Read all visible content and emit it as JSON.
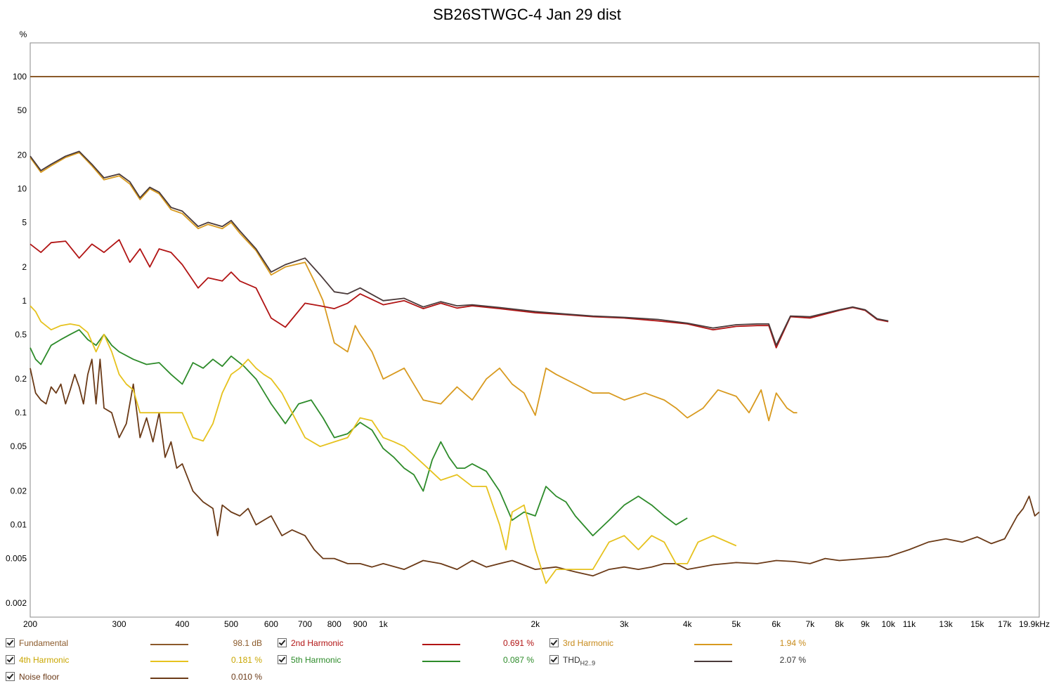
{
  "chart_data": {
    "type": "line",
    "title": "SB26STWGC-4 Jan 29 dist",
    "ylabel": "%",
    "x_scale": "log",
    "y_scale": "log",
    "xlim": [
      200,
      19900
    ],
    "ylim": [
      0.0015,
      200
    ],
    "x_ticks": [
      200,
      300,
      400,
      500,
      600,
      700,
      800,
      900,
      1000,
      2000,
      3000,
      4000,
      5000,
      6000,
      7000,
      8000,
      9000,
      10000,
      11000,
      13000,
      15000,
      17000,
      19900
    ],
    "x_tick_labels": [
      "200",
      "300",
      "400",
      "500",
      "600",
      "700",
      "800",
      "900",
      "1k",
      "2k",
      "3k",
      "4k",
      "5k",
      "6k",
      "7k",
      "8k",
      "9k",
      "10k",
      "11k",
      "13k",
      "15k",
      "17k",
      "19.9kHz"
    ],
    "y_ticks": [
      100,
      50,
      20,
      10,
      5,
      2,
      1,
      0.5,
      0.2,
      0.1,
      0.05,
      0.02,
      0.01,
      0.005,
      0.002
    ],
    "y_tick_labels": [
      "100",
      "50",
      "20",
      "10",
      "5",
      "2",
      "1",
      "0.5",
      "0.2",
      "0.1",
      "0.05",
      "0.02",
      "0.01",
      "0.005",
      "0.002"
    ],
    "grid": true,
    "legend_position": "bottom",
    "series": [
      {
        "key": "fundamental",
        "name": "Fundamental",
        "color": "#8b5a2b",
        "x": [
          200,
          19900
        ],
        "y": [
          100,
          100
        ]
      },
      {
        "key": "h2",
        "name": "2nd Harmonic",
        "color": "#b11414",
        "x": [
          200,
          210,
          220,
          235,
          250,
          265,
          280,
          300,
          315,
          330,
          345,
          360,
          380,
          400,
          430,
          450,
          480,
          500,
          520,
          560,
          600,
          640,
          700,
          750,
          800,
          850,
          900,
          1000,
          1100,
          1200,
          1300,
          1400,
          1500,
          1700,
          2000,
          2300,
          2600,
          3000,
          3500,
          4000,
          4500,
          5000,
          5500,
          5800,
          6000,
          6400,
          7000,
          8000,
          8500,
          9000,
          9500,
          10000
        ],
        "y": [
          3.2,
          2.7,
          3.3,
          3.4,
          2.4,
          3.2,
          2.7,
          3.5,
          2.2,
          2.9,
          2.0,
          2.9,
          2.7,
          2.1,
          1.3,
          1.6,
          1.5,
          1.8,
          1.5,
          1.3,
          0.7,
          0.58,
          0.95,
          0.9,
          0.85,
          0.95,
          1.15,
          0.92,
          1.0,
          0.85,
          0.95,
          0.86,
          0.9,
          0.85,
          0.78,
          0.75,
          0.72,
          0.7,
          0.66,
          0.62,
          0.55,
          0.59,
          0.6,
          0.6,
          0.38,
          0.72,
          0.7,
          0.82,
          0.87,
          0.82,
          0.68,
          0.65
        ]
      },
      {
        "key": "h3",
        "name": "3rd Harmonic",
        "color": "#d89a1f",
        "x": [
          200,
          210,
          220,
          235,
          250,
          265,
          280,
          300,
          315,
          330,
          345,
          360,
          380,
          400,
          430,
          450,
          480,
          500,
          520,
          560,
          600,
          640,
          700,
          730,
          760,
          800,
          850,
          880,
          900,
          950,
          1000,
          1100,
          1200,
          1300,
          1400,
          1500,
          1600,
          1700,
          1800,
          1900,
          2000,
          2100,
          2200,
          2400,
          2600,
          2800,
          3000,
          3300,
          3600,
          3800,
          4000,
          4300,
          4600,
          5000,
          5300,
          5600,
          5800,
          6000,
          6300,
          6500,
          6600
        ],
        "y": [
          19,
          14,
          16,
          19,
          21,
          16,
          12,
          13,
          11,
          8,
          10,
          9,
          6.5,
          6.0,
          4.4,
          4.8,
          4.4,
          5.0,
          4.0,
          2.8,
          1.7,
          2.0,
          2.2,
          1.5,
          1.0,
          0.42,
          0.35,
          0.6,
          0.5,
          0.35,
          0.2,
          0.25,
          0.13,
          0.12,
          0.17,
          0.13,
          0.2,
          0.25,
          0.18,
          0.15,
          0.095,
          0.25,
          0.22,
          0.18,
          0.15,
          0.15,
          0.13,
          0.15,
          0.13,
          0.11,
          0.09,
          0.11,
          0.16,
          0.14,
          0.1,
          0.16,
          0.085,
          0.15,
          0.11,
          0.1,
          0.1
        ]
      },
      {
        "key": "h4",
        "name": "4th Harmonic",
        "color": "#e6c21e",
        "x": [
          200,
          205,
          210,
          220,
          230,
          240,
          250,
          260,
          270,
          280,
          290,
          300,
          310,
          320,
          330,
          345,
          360,
          380,
          400,
          420,
          440,
          460,
          480,
          500,
          520,
          540,
          560,
          580,
          600,
          630,
          660,
          700,
          750,
          800,
          850,
          900,
          950,
          1000,
          1050,
          1100,
          1200,
          1300,
          1400,
          1500,
          1600,
          1700,
          1750,
          1800,
          1900,
          2000,
          2100,
          2200,
          2300,
          2400,
          2600,
          2800,
          3000,
          3200,
          3400,
          3600,
          3800,
          4000,
          4200,
          4500,
          5000
        ],
        "y": [
          0.9,
          0.8,
          0.65,
          0.55,
          0.6,
          0.62,
          0.6,
          0.52,
          0.35,
          0.5,
          0.35,
          0.22,
          0.18,
          0.16,
          0.1,
          0.1,
          0.1,
          0.1,
          0.1,
          0.06,
          0.056,
          0.08,
          0.15,
          0.22,
          0.25,
          0.3,
          0.25,
          0.22,
          0.2,
          0.15,
          0.1,
          0.06,
          0.05,
          0.055,
          0.06,
          0.09,
          0.085,
          0.06,
          0.055,
          0.05,
          0.035,
          0.025,
          0.028,
          0.022,
          0.022,
          0.01,
          0.006,
          0.013,
          0.015,
          0.006,
          0.003,
          0.004,
          0.004,
          0.004,
          0.004,
          0.007,
          0.008,
          0.006,
          0.008,
          0.007,
          0.0045,
          0.0045,
          0.007,
          0.008,
          0.0065
        ]
      },
      {
        "key": "h5",
        "name": "5th Harmonic",
        "color": "#2d8b2a",
        "x": [
          200,
          205,
          210,
          220,
          230,
          240,
          250,
          260,
          270,
          280,
          290,
          300,
          320,
          340,
          360,
          380,
          400,
          420,
          440,
          460,
          480,
          500,
          530,
          560,
          600,
          640,
          680,
          720,
          760,
          800,
          850,
          900,
          950,
          1000,
          1050,
          1100,
          1150,
          1200,
          1250,
          1300,
          1350,
          1400,
          1450,
          1500,
          1600,
          1700,
          1800,
          1900,
          2000,
          2100,
          2200,
          2300,
          2400,
          2600,
          2800,
          3000,
          3200,
          3400,
          3600,
          3800,
          4000
        ],
        "y": [
          0.38,
          0.3,
          0.27,
          0.4,
          0.45,
          0.5,
          0.55,
          0.45,
          0.4,
          0.5,
          0.4,
          0.35,
          0.3,
          0.27,
          0.28,
          0.22,
          0.18,
          0.28,
          0.25,
          0.3,
          0.26,
          0.32,
          0.26,
          0.2,
          0.12,
          0.08,
          0.12,
          0.13,
          0.09,
          0.06,
          0.065,
          0.082,
          0.07,
          0.048,
          0.04,
          0.032,
          0.028,
          0.02,
          0.038,
          0.055,
          0.04,
          0.032,
          0.032,
          0.035,
          0.03,
          0.02,
          0.011,
          0.013,
          0.012,
          0.022,
          0.018,
          0.016,
          0.012,
          0.008,
          0.011,
          0.015,
          0.018,
          0.015,
          0.012,
          0.01,
          0.0115
        ]
      },
      {
        "key": "noise",
        "name": "Noise floor",
        "color": "#6b3a17",
        "x": [
          200,
          205,
          210,
          215,
          220,
          225,
          230,
          235,
          240,
          245,
          250,
          255,
          260,
          265,
          270,
          275,
          280,
          290,
          300,
          310,
          320,
          330,
          340,
          350,
          360,
          370,
          380,
          390,
          400,
          420,
          440,
          460,
          470,
          480,
          500,
          520,
          540,
          560,
          580,
          600,
          630,
          660,
          700,
          730,
          760,
          800,
          850,
          900,
          950,
          1000,
          1100,
          1200,
          1300,
          1400,
          1500,
          1600,
          1700,
          1800,
          2000,
          2200,
          2400,
          2600,
          2800,
          3000,
          3200,
          3400,
          3600,
          3800,
          4000,
          4500,
          5000,
          5500,
          6000,
          6500,
          7000,
          7500,
          8000,
          9000,
          10000,
          11000,
          12000,
          13000,
          14000,
          15000,
          16000,
          17000,
          18000,
          18500,
          19000,
          19500,
          19900
        ],
        "y": [
          0.25,
          0.15,
          0.13,
          0.12,
          0.17,
          0.15,
          0.18,
          0.12,
          0.16,
          0.22,
          0.17,
          0.12,
          0.22,
          0.3,
          0.12,
          0.3,
          0.11,
          0.1,
          0.06,
          0.08,
          0.18,
          0.06,
          0.09,
          0.055,
          0.1,
          0.04,
          0.055,
          0.032,
          0.035,
          0.02,
          0.016,
          0.014,
          0.008,
          0.015,
          0.013,
          0.012,
          0.014,
          0.01,
          0.011,
          0.012,
          0.008,
          0.009,
          0.008,
          0.006,
          0.005,
          0.005,
          0.0045,
          0.0045,
          0.0042,
          0.0045,
          0.004,
          0.0048,
          0.0045,
          0.004,
          0.0048,
          0.0042,
          0.0045,
          0.0048,
          0.004,
          0.0042,
          0.0038,
          0.0035,
          0.004,
          0.0042,
          0.004,
          0.0042,
          0.0045,
          0.0045,
          0.004,
          0.0044,
          0.0046,
          0.0045,
          0.0048,
          0.0047,
          0.0045,
          0.005,
          0.0048,
          0.005,
          0.0052,
          0.006,
          0.007,
          0.0075,
          0.007,
          0.0078,
          0.0068,
          0.0075,
          0.012,
          0.014,
          0.018,
          0.012,
          0.013
        ]
      },
      {
        "key": "thd",
        "name": "THD",
        "name_sub": "H2..9",
        "color": "#4a3a3a",
        "x": [
          200,
          210,
          220,
          235,
          250,
          265,
          280,
          300,
          315,
          330,
          345,
          360,
          380,
          400,
          430,
          450,
          480,
          500,
          520,
          560,
          600,
          640,
          700,
          750,
          800,
          850,
          900,
          1000,
          1100,
          1200,
          1300,
          1400,
          1500,
          1700,
          2000,
          2300,
          2600,
          3000,
          3500,
          4000,
          4500,
          5000,
          5500,
          5800,
          6000,
          6400,
          7000,
          8000,
          8500,
          9000,
          9500,
          10000
        ],
        "y": [
          19.5,
          14.5,
          16.5,
          19.5,
          21.5,
          16.5,
          12.5,
          13.5,
          11.5,
          8.3,
          10.3,
          9.3,
          6.8,
          6.3,
          4.6,
          5.0,
          4.6,
          5.2,
          4.2,
          2.9,
          1.8,
          2.1,
          2.4,
          1.7,
          1.2,
          1.15,
          1.3,
          1.0,
          1.05,
          0.88,
          0.98,
          0.9,
          0.92,
          0.87,
          0.8,
          0.76,
          0.73,
          0.71,
          0.68,
          0.63,
          0.57,
          0.61,
          0.62,
          0.62,
          0.4,
          0.73,
          0.72,
          0.83,
          0.88,
          0.83,
          0.69,
          0.66
        ]
      }
    ]
  },
  "legend": {
    "items": [
      {
        "key": "fundamental",
        "label": "Fundamental",
        "sub": "",
        "value": "98.1 dB",
        "label_color": "#8b5a2b",
        "line_color": "#8b5a2b"
      },
      {
        "key": "h2",
        "label": "2nd Harmonic",
        "sub": "",
        "value": "0.691 %",
        "label_color": "#b11414",
        "line_color": "#b11414"
      },
      {
        "key": "h3",
        "label": "3rd Harmonic",
        "sub": "",
        "value": "1.94 %",
        "label_color": "#c78a1a",
        "line_color": "#d89a1f"
      },
      {
        "key": "h4",
        "label": "4th Harmonic",
        "sub": "",
        "value": "0.181 %",
        "label_color": "#c9a600",
        "line_color": "#e6c21e"
      },
      {
        "key": "h5",
        "label": "5th Harmonic",
        "sub": "",
        "value": "0.087 %",
        "label_color": "#2d8b2a",
        "line_color": "#2d8b2a"
      },
      {
        "key": "thd",
        "label": "THD",
        "sub": "H2..9",
        "value": "2.07 %",
        "label_color": "#333333",
        "line_color": "#4a3a3a"
      },
      {
        "key": "noise",
        "label": "Noise floor",
        "sub": "",
        "value": "0.010 %",
        "label_color": "#6b3a17",
        "line_color": "#6b3a17"
      }
    ]
  }
}
